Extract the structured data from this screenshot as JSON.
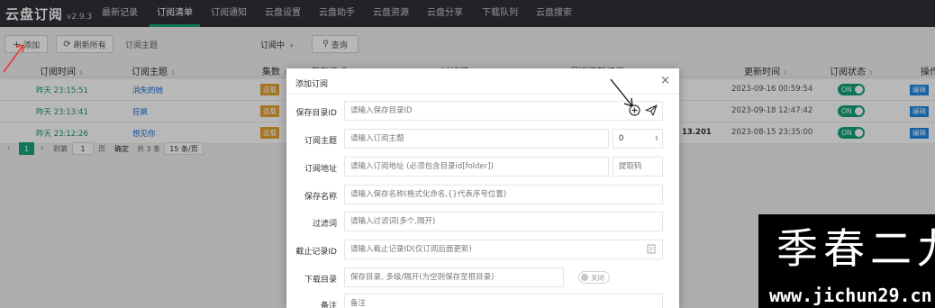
{
  "app": {
    "title": "云盘订阅",
    "version": "v2.9.3"
  },
  "nav": [
    "最新记录",
    "订阅清单",
    "订阅通知",
    "云盘设置",
    "云盘助手",
    "云盘资源",
    "云盘分享",
    "下载队列",
    "云盘搜索"
  ],
  "toolbar": {
    "add_label": "添加",
    "refresh_label": "刷新所有",
    "topic_placeholder": "订阅主题",
    "status_select": "订阅中",
    "query_label": "查询"
  },
  "table": {
    "headers": [
      "订阅时间",
      "订阅主题",
      "集数",
      "保存格式",
      "过滤词",
      "最近更新记录",
      "更新时间",
      "订阅状态",
      "操作"
    ],
    "rows": [
      {
        "time": "昨天 23:15:51",
        "topic": "消失的她",
        "tag": "连载",
        "update_time": "2023-09-16 00:59:54",
        "status": "ON",
        "action": "编辑"
      },
      {
        "time": "昨天 23:13:41",
        "topic": "狂飙",
        "tag": "连载",
        "update_time": "2023-09-18 12:47:42",
        "status": "ON",
        "action": "编辑"
      },
      {
        "time": "昨天 23:12:26",
        "topic": "想见你",
        "tag": "连载",
        "record_partial": "13.201",
        "update_time": "2023-08-15 23:35:00",
        "status": "ON",
        "action": "编辑"
      }
    ]
  },
  "pager": {
    "current": "1",
    "goto_label": "到第",
    "page_input": "1",
    "page_unit": "页",
    "confirm": "确定",
    "total": "共 3 条",
    "page_size": "15 条/页"
  },
  "modal": {
    "title": "添加订阅",
    "fields": {
      "save_dir": {
        "label": "保存目录ID",
        "placeholder": "请输入保存目录ID"
      },
      "topic": {
        "label": "订阅主题",
        "placeholder": "请输入订阅主题",
        "count": "0"
      },
      "url": {
        "label": "订阅地址",
        "placeholder": "请输入订阅地址 (必须包含目录id[folder])",
        "code_placeholder": "提取码"
      },
      "save_name": {
        "label": "保存名称",
        "placeholder": "请输入保存名称(格式化命名,{}代表序号位置)"
      },
      "filter": {
        "label": "过滤词",
        "placeholder": "请输入过滤词(多个,隔开)"
      },
      "stop_record": {
        "label": "截止记录ID",
        "placeholder": "请输入截止记录ID(仅订阅后面更新)"
      },
      "download_dir": {
        "label": "下载目录",
        "placeholder": "保存目录, 多级/隔开(为空则保存至根目录)",
        "toggle": "关闭"
      },
      "note": {
        "label": "备注",
        "placeholder": "备注"
      }
    }
  },
  "watermark": {
    "main": "季春二九",
    "site": "www.jichun29.cn"
  },
  "colors": {
    "nav_bg": "#2f3138",
    "accent": "#14a57a",
    "tag": "#e5a22d",
    "link": "#1e6fd9",
    "annotation": "#e53935"
  }
}
